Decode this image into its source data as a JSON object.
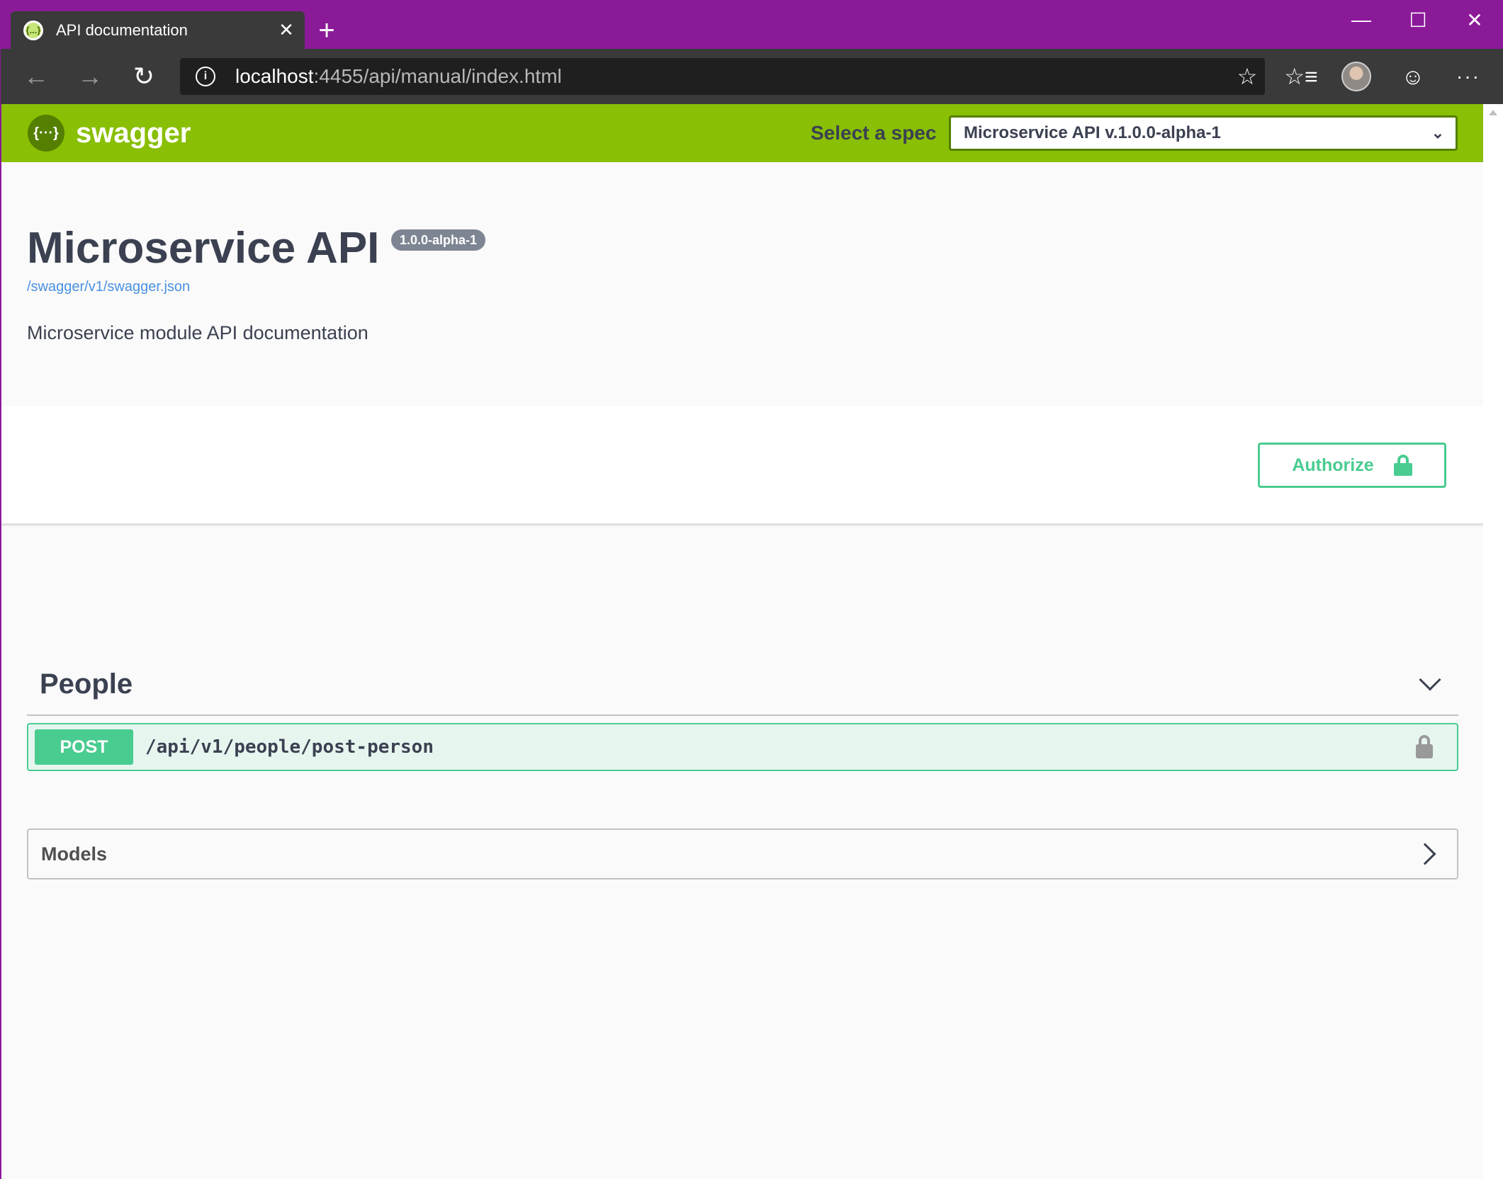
{
  "browser": {
    "tab_title": "API documentation",
    "favicon_text": "{...}",
    "tab_close": "✕",
    "new_tab": "+",
    "url_host": "localhost",
    "url_rest": ":4455/api/manual/index.html",
    "window_controls": {
      "minimize": "—",
      "maximize": "☐",
      "close": "✕"
    },
    "nav": {
      "back": "←",
      "forward": "→",
      "reload": "↻"
    },
    "toolbar_icons": {
      "star": "☆",
      "favorites": "☆≡",
      "emoji": "☺",
      "more": "···"
    }
  },
  "swagger": {
    "brand": "swagger",
    "logo_text": "{···}",
    "spec_label": "Select a spec",
    "spec_selected": "Microservice API v.1.0.0-alpha-1",
    "spec_chevron": "⌄"
  },
  "info": {
    "title": "Microservice API",
    "version": "1.0.0-alpha-1",
    "spec_url": "/swagger/v1/swagger.json",
    "description": "Microservice module API documentation"
  },
  "authorize": {
    "label": "Authorize"
  },
  "tags": [
    {
      "name": "People",
      "operations": [
        {
          "method": "POST",
          "path": "/api/v1/people/post-person"
        }
      ]
    }
  ],
  "models": {
    "title": "Models"
  },
  "colors": {
    "window_frame": "#8b1a99",
    "swagger_green": "#89bf04",
    "post_green": "#49cc90",
    "text_dark": "#3b4151",
    "link_blue": "#4990e2"
  }
}
